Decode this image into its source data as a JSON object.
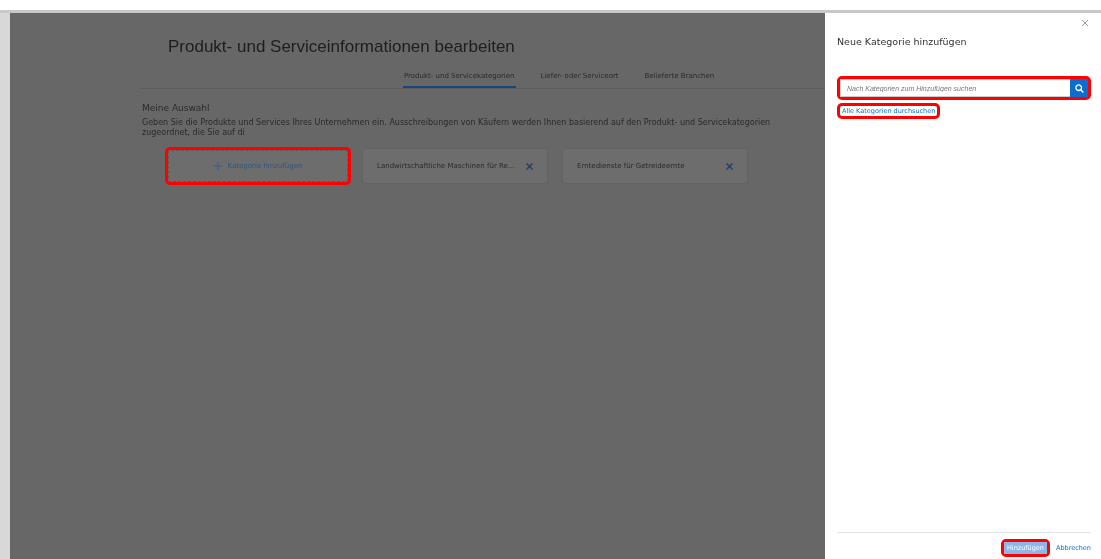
{
  "page": {
    "title": "Produkt- und Serviceinformationen bearbeiten",
    "tabs": [
      {
        "label": "Produkt- und Servicekategorien",
        "selected": true
      },
      {
        "label": "Liefer- oder Serviceort",
        "selected": false
      },
      {
        "label": "Belieferte Branchen",
        "selected": false
      }
    ],
    "section_title": "Meine Auswahl",
    "description": "Geben Sie die Produkte und Services Ihres Unternehmen ein. Ausschreibungen von Käufern werden Ihnen basierend auf den Produkt- und Servicekategorien zugeordnet, die Sie auf di",
    "cards": [
      {
        "kind": "add",
        "label": "Kategorie hinzufügen",
        "highlighted": true
      },
      {
        "kind": "category",
        "label": "Landwirtschaftliche Maschinen für Re...",
        "highlighted": false
      },
      {
        "kind": "category",
        "label": "Erntedienste für Getreideernte",
        "highlighted": false
      }
    ]
  },
  "dialog": {
    "title": "Neue Kategorie hinzufügen",
    "search": {
      "placeholder": "Nach Kategorien zum Hinzufügen suchen",
      "highlighted": true
    },
    "link": {
      "label": "Alle Kategorien durchsuchen",
      "highlighted": true
    },
    "buttons": [
      {
        "kind": "primary",
        "label": "Hinzufügen",
        "highlighted": true
      },
      {
        "kind": "link",
        "label": "Abbrechen",
        "highlighted": false
      }
    ]
  }
}
